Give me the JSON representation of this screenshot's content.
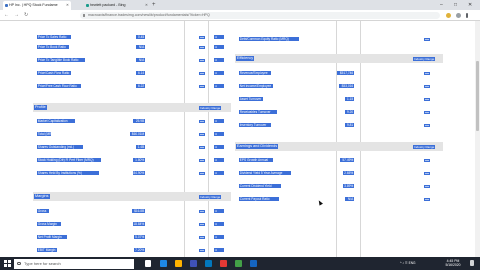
{
  "browser": {
    "tabs": [
      {
        "title": "HP Inc. | HPQ Stock Fundame",
        "active": true
      },
      {
        "title": "hewlett packard - Bing",
        "active": false
      }
    ],
    "new_tab": "+",
    "window_controls": {
      "minimize": "–",
      "maximize": "□",
      "close": "✕"
    },
    "nav": {
      "back": "←",
      "forward": "→",
      "reload": "↻"
    },
    "url": "macroaxis/finance.tradesimg.com/newlib/product/fundamentals/?ticker=HPQ"
  },
  "page": {
    "left_column": {
      "group1_rows": [
        {
          "label": "Price To Sales Ratio",
          "value": "0.45"
        },
        {
          "label": "Price To Book Ratio",
          "value": "N/A"
        },
        {
          "label": "Price To Tangible Book Ratio",
          "value": "N/A"
        },
        {
          "label": "Price/Cash Flow Ratio",
          "value": "6.14"
        },
        {
          "label": "Price/Free Cash Flow Ratio",
          "value": "6.22"
        }
      ],
      "profile_section": {
        "title": "Profile",
        "right": "Industry Range"
      },
      "profile_rows": [
        {
          "label": "Market Capitalization",
          "value": "25.9B"
        },
        {
          "label": "Total (MRQ)",
          "value": "$60.01M"
        },
        {
          "label": "Shares Outstanding (mil.)",
          "value": "1.4B"
        },
        {
          "label": "Stock Holding (Dfr) Fl Perf Fiber (MRQ)",
          "value": "1.80%"
        },
        {
          "label": "Shares Held By Institutions (%)",
          "value": "84.90%"
        }
      ],
      "margins_section": {
        "title": "Margins",
        "right": "Industry Range"
      },
      "margin_rows": [
        {
          "label": "Gross",
          "value": "$16.8B"
        },
        {
          "label": "Gross Margin",
          "value": "18.84%"
        },
        {
          "label": "Net Profit Margin",
          "value": "5.07%"
        },
        {
          "label": "EBIT Margin",
          "value": "7.20%"
        }
      ]
    },
    "right_column": {
      "top_row": {
        "label": "Debt/Common Equity Ratio (MRQ)",
        "value": ""
      },
      "efficiency_section": {
        "title": "Efficiency",
        "right": "Industry Range"
      },
      "efficiency_rows": [
        {
          "label": "Revenue/Employee",
          "value": "$517,746"
        },
        {
          "label": "Net Income/Employee",
          "value": "$53,016"
        },
        {
          "label": "Asset Turnover",
          "value": "1.15"
        },
        {
          "label": "Receivables Turnover",
          "value": "9.20"
        },
        {
          "label": "Inventory Turnover",
          "value": "9.81"
        }
      ],
      "earnings_section": {
        "title": "Earnings and Dividends",
        "right": "Industry Range"
      },
      "earnings_rows": [
        {
          "label": "EPS Growth Annual",
          "value": "57.49%"
        },
        {
          "label": "Dividend Yield 5 Year Average",
          "value": "2.65%"
        },
        {
          "label": "Current Dividend Yield",
          "value": "3.89%"
        },
        {
          "label": "Current Payout Ratio",
          "value": "N/A"
        }
      ]
    },
    "industry_cell": "▪▪"
  },
  "taskbar": {
    "search_placeholder": "Type here for search",
    "tray_text": "^  ♪  ☰  ENG",
    "time": "4:45 PM",
    "date": "5/16/2020"
  }
}
